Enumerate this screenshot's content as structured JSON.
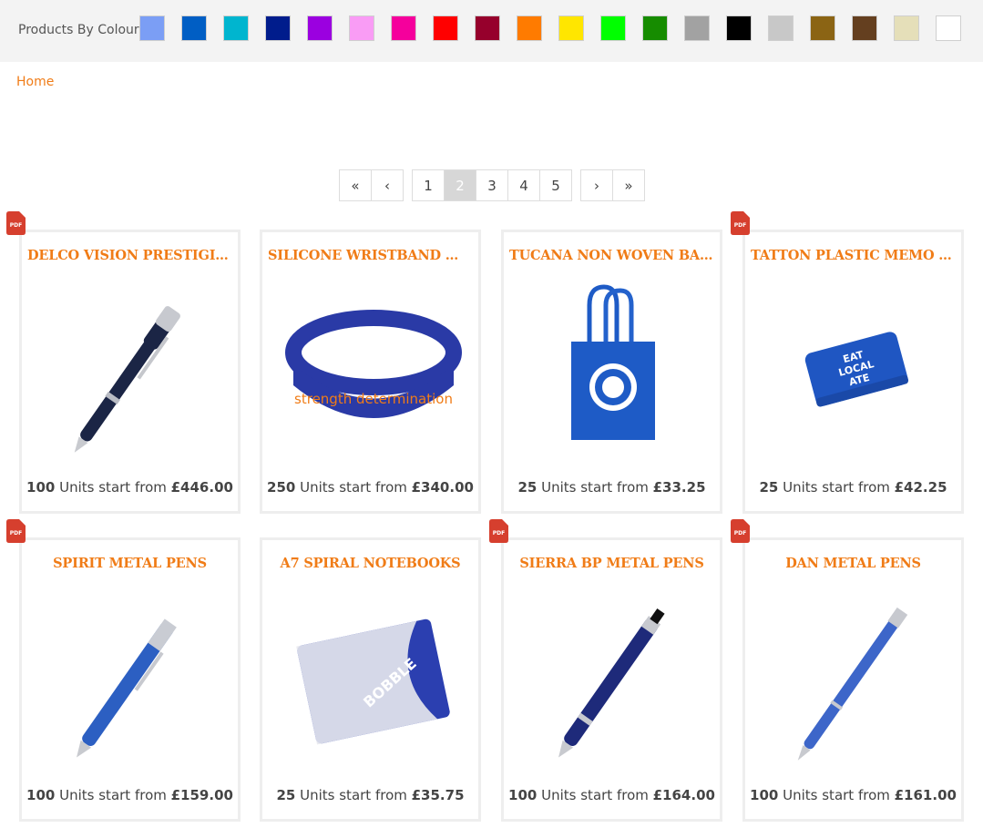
{
  "colour_filter": {
    "label": "Products By Colour:",
    "swatches": [
      "#7b9ef5",
      "#005ec4",
      "#00b5cf",
      "#001c8c",
      "#9b00e0",
      "#f99cf5",
      "#f5009c",
      "#ff0000",
      "#96002c",
      "#ff7b00",
      "#ffe600",
      "#00ff00",
      "#168c00",
      "#a2a2a2",
      "#000000",
      "#c8c8c8",
      "#8b6414",
      "#643f1f",
      "#e5dfb9",
      "#ffffff"
    ]
  },
  "breadcrumb": {
    "home": "Home"
  },
  "pagination": {
    "first": "«",
    "prev": "‹",
    "next": "›",
    "last": "»",
    "pages": [
      "1",
      "2",
      "3",
      "4",
      "5"
    ],
    "current_page": "2"
  },
  "pdf_label": "PDF",
  "products": [
    {
      "title": "DELCO VISION PRESTIGIOUS ...",
      "qty": "100",
      "text": " Units start from ",
      "price": "£446.00",
      "pdf": true,
      "image": "black-pen"
    },
    {
      "title": "SILICONE WRISTBAND WITH ...",
      "qty": "250",
      "text": " Units start from ",
      "price": "£340.00",
      "pdf": false,
      "image": "wristband",
      "wristband_text": "strength  determination"
    },
    {
      "title": "TUCANA NON WOVEN BAGS",
      "qty": "25",
      "text": " Units start from ",
      "price": "£33.25",
      "pdf": false,
      "image": "tote-bag"
    },
    {
      "title": "TATTON PLASTIC MEMO HO...",
      "qty": "25",
      "text": " Units start from ",
      "price": "£42.25",
      "pdf": true,
      "image": "memo-holder",
      "memo_text": [
        "EAT",
        "LOCAL",
        "ATE"
      ]
    },
    {
      "title": "SPIRIT METAL PENS",
      "qty": "100",
      "text": " Units start from ",
      "price": "£159.00",
      "pdf": true,
      "image": "blue-pen"
    },
    {
      "title": "A7 SPIRAL NOTEBOOKS",
      "qty": "25",
      "text": " Units start from ",
      "price": "£35.75",
      "pdf": false,
      "image": "notebook",
      "notebook_text": "BOBBLE"
    },
    {
      "title": "SIERRA BP METAL PENS",
      "qty": "100",
      "text": " Units start from ",
      "price": "£164.00",
      "pdf": true,
      "image": "navy-pen"
    },
    {
      "title": "DAN METAL PENS",
      "qty": "100",
      "text": " Units start from ",
      "price": "£161.00",
      "pdf": true,
      "image": "blue-pen-2"
    }
  ]
}
